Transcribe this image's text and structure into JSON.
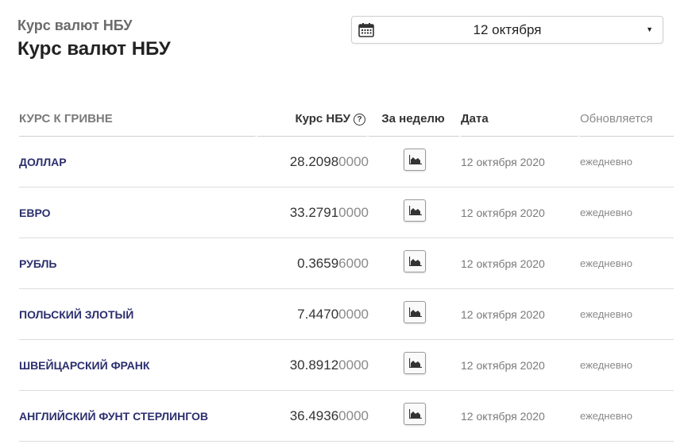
{
  "header": {
    "subtitle": "Курс валют НБУ",
    "title": "Курс валют НБУ"
  },
  "date_picker": {
    "selected": "12 октября",
    "icon": "calendar-icon",
    "caret": "▼"
  },
  "table": {
    "columns": {
      "name": "КУРС К ГРИВНЕ",
      "rate": "Курс НБУ",
      "rate_help": "?",
      "week": "За неделю",
      "date": "Дата",
      "updated": "Обновляется"
    },
    "rows": [
      {
        "name": "ДОЛЛАР",
        "rate_main": "28.2098",
        "rate_tail": "0000",
        "date": "12 октября 2020",
        "updated": "ежедневно"
      },
      {
        "name": "ЕВРО",
        "rate_main": "33.2791",
        "rate_tail": "0000",
        "date": "12 октября 2020",
        "updated": "ежедневно"
      },
      {
        "name": "РУБЛЬ",
        "rate_main": "0.3659",
        "rate_tail": "6000",
        "date": "12 октября 2020",
        "updated": "ежедневно"
      },
      {
        "name": "ПОЛЬСКИЙ ЗЛОТЫЙ",
        "rate_main": "7.4470",
        "rate_tail": "0000",
        "date": "12 октября 2020",
        "updated": "ежедневно"
      },
      {
        "name": "ШВЕЙЦАРСКИЙ ФРАНК",
        "rate_main": "30.8912",
        "rate_tail": "0000",
        "date": "12 октября 2020",
        "updated": "ежедневно"
      },
      {
        "name": "АНГЛИЙСКИЙ ФУНТ СТЕРЛИНГОВ",
        "rate_main": "36.4936",
        "rate_tail": "0000",
        "date": "12 октября 2020",
        "updated": "ежедневно"
      }
    ],
    "week_button_icon": "area-chart-icon"
  },
  "colors": {
    "currency_name": "#2c2f6e",
    "muted": "#8a8a8a",
    "border": "#dcdcdc"
  }
}
